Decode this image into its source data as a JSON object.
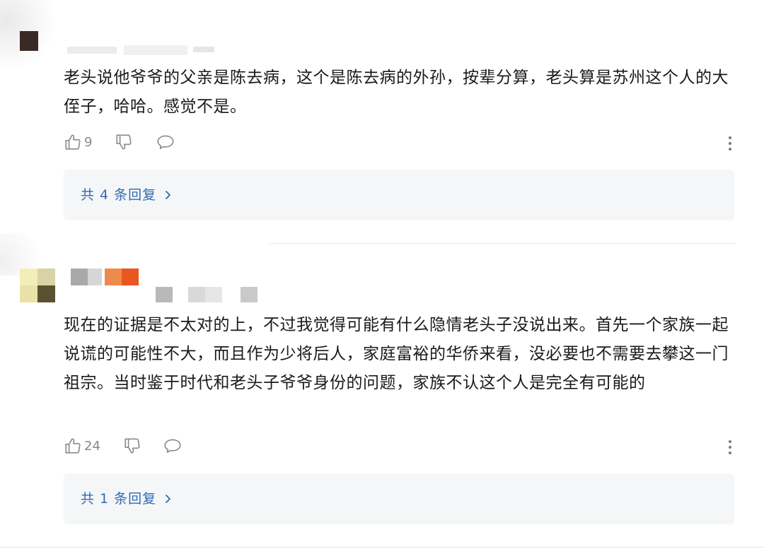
{
  "comments": [
    {
      "text": "老头说他爷爷的父亲是陈去病，这个是陈去病的外孙，按辈分算，老头算是苏州这个人的大侄子，哈哈。感觉不是。",
      "likes": "9",
      "replies_label": "共 4 条回复"
    },
    {
      "text": "现在的证据是不太对的上，不过我觉得可能有什么隐情老头子没说出来。首先一个家族一起说谎的可能性不大，而且作为少将后人，家庭富裕的华侨来看，没必要也不需要去攀这一门祖宗。当时鉴于时代和老头子爷爷身份的问题，家族不认这个人是完全有可能的",
      "likes": "24",
      "replies_label": "共 1 条回复"
    }
  ],
  "icons": {
    "like": "thumbs-up-icon",
    "dislike": "thumbs-down-icon",
    "comment": "speech-bubble-icon",
    "more": "more-vertical-icon",
    "chevron": "chevron-right-icon"
  },
  "colors": {
    "link": "#2f6bb5",
    "reply_bg": "#f5f6f7",
    "icon": "#8a8a8a"
  }
}
